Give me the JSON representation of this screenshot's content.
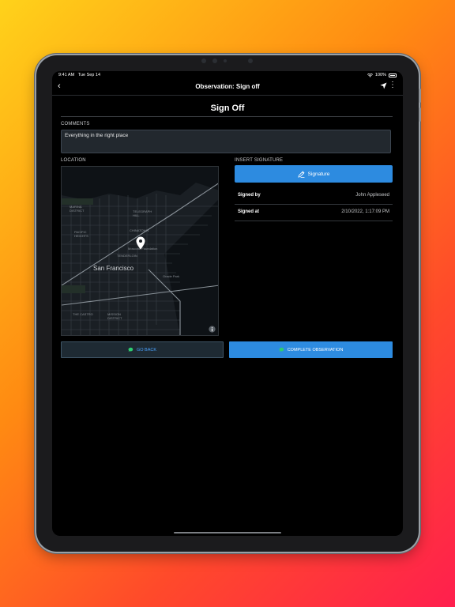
{
  "status_bar": {
    "time": "9:41 AM",
    "date": "Tue Sep 14",
    "battery": "100%"
  },
  "nav": {
    "title": "Observation: Sign off",
    "back_icon": "chevron-left-icon",
    "locate_icon": "location-arrow-icon",
    "more_icon": "more-vertical-icon"
  },
  "page": {
    "title": "Sign Off"
  },
  "comments": {
    "label": "COMMENTS",
    "value": "Everything in the right place"
  },
  "location": {
    "label": "LOCATION",
    "map_labels": {
      "marina": "MARINA\nDISTRICT",
      "telegraph": "TELEGRAPH\nHILL",
      "pacific": "PACIFIC\nHEIGHTS",
      "chinatown": "CHINATOWN",
      "city": "San Francisco",
      "tenderloin": "TENDERLOIN",
      "moscone": "Moscone Foundation",
      "oracle": "Oracle Park",
      "castro": "THE CASTRO",
      "mission": "MISSION\nDISTRICT"
    }
  },
  "signature": {
    "label": "INSERT SIGNATURE",
    "button_label": "Signature",
    "rows": [
      {
        "key": "Signed by",
        "value": "John Appleseed"
      },
      {
        "key": "Signed at",
        "value": "2/10/2022, 1:17:09 PM"
      }
    ]
  },
  "actions": {
    "back_label": "GO BACK",
    "complete_label": "COMPLETE OBSERVATION"
  },
  "colors": {
    "accent": "#2d8be0",
    "chat_icon": "#2ecc71",
    "background": "#000000"
  }
}
